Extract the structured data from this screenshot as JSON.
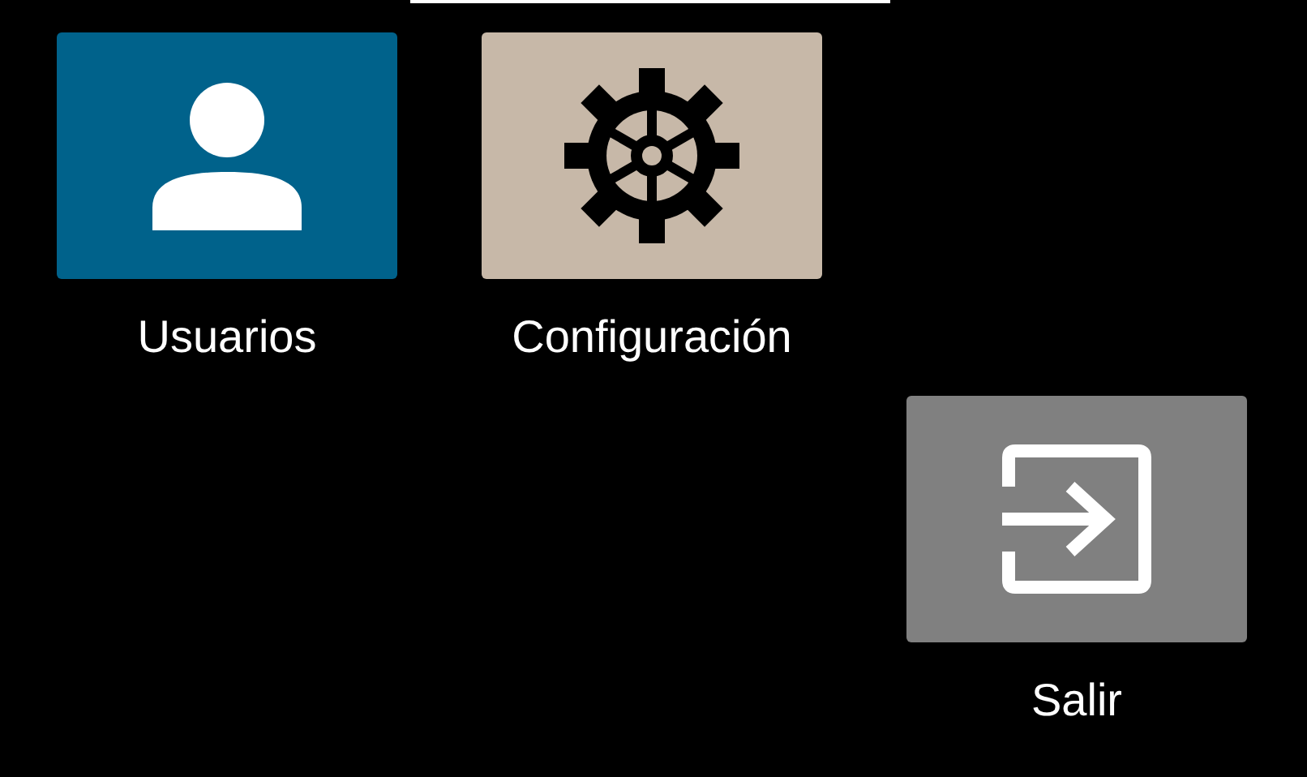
{
  "tiles": [
    {
      "label": "Usuarios",
      "kind": "user",
      "color": "#00628b"
    },
    {
      "label": "Configuración",
      "kind": "settings",
      "color": "#c7b8a8"
    },
    {
      "label": "Salir",
      "kind": "exit",
      "color": "#808080"
    }
  ]
}
